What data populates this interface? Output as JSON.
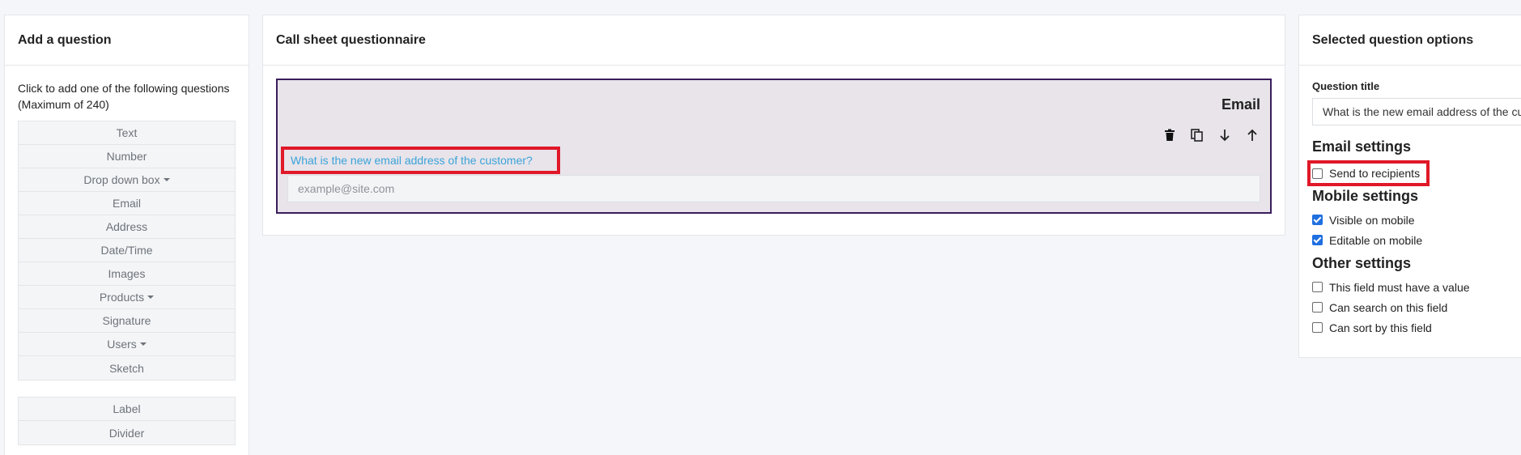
{
  "left": {
    "title": "Add a question",
    "intro": "Click to add one of the following questions (Maximum of 240)",
    "items": [
      {
        "label": "Text",
        "dropdown": false
      },
      {
        "label": "Number",
        "dropdown": false
      },
      {
        "label": "Drop down box",
        "dropdown": true
      },
      {
        "label": "Email",
        "dropdown": false
      },
      {
        "label": "Address",
        "dropdown": false
      },
      {
        "label": "Date/Time",
        "dropdown": false
      },
      {
        "label": "Images",
        "dropdown": false
      },
      {
        "label": "Products",
        "dropdown": true
      },
      {
        "label": "Signature",
        "dropdown": false
      },
      {
        "label": "Users",
        "dropdown": true
      },
      {
        "label": "Sketch",
        "dropdown": false
      }
    ],
    "extra_items": [
      {
        "label": "Label"
      },
      {
        "label": "Divider"
      }
    ]
  },
  "middle": {
    "title": "Call sheet questionnaire",
    "question": {
      "type": "Email",
      "label": "What is the new email address of the customer?",
      "placeholder": "example@site.com"
    },
    "tools": [
      "trash-icon",
      "copy-icon",
      "arrow-down-icon",
      "arrow-up-icon"
    ]
  },
  "right": {
    "title": "Selected question options",
    "question_title_label": "Question title",
    "question_title_value": "What is the new email address of the customer?",
    "email_settings": {
      "heading": "Email settings",
      "send_to_recipients": {
        "label": "Send to recipients",
        "checked": false
      }
    },
    "mobile_settings": {
      "heading": "Mobile settings",
      "visible": {
        "label": "Visible on mobile",
        "checked": true
      },
      "editable": {
        "label": "Editable on mobile",
        "checked": true
      }
    },
    "other_settings": {
      "heading": "Other settings",
      "required": {
        "label": "This field must have a value",
        "checked": false
      },
      "searchable": {
        "label": "Can search on this field",
        "checked": false
      },
      "sortable": {
        "label": "Can sort by this field",
        "checked": false
      }
    }
  },
  "colors": {
    "highlight": "#e01828",
    "question_border": "#3a1d5c",
    "question_bg": "#e8e4ea",
    "label_link": "#3aa3d9",
    "checkbox_checked": "#1f6fe0"
  }
}
